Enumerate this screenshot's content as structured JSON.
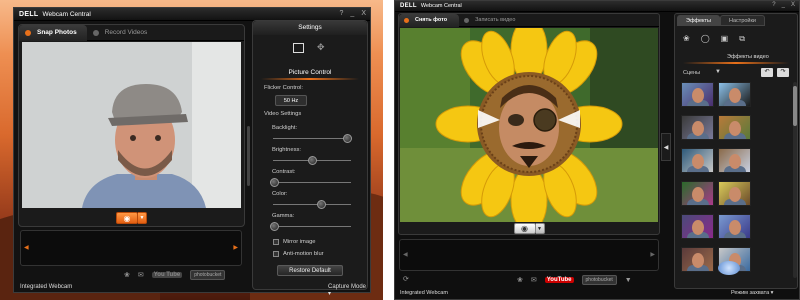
{
  "left_window": {
    "brand": "DELL",
    "title": "Webcam Central",
    "controls": [
      "?",
      "_",
      "X"
    ],
    "tabs": [
      {
        "label": "Snap Photos",
        "active": true
      },
      {
        "label": "Record Videos",
        "active": false
      }
    ],
    "status": "Integrated Webcam",
    "settings": {
      "title": "Settings",
      "section": "Picture Control",
      "flicker_label": "Flicker Control:",
      "flicker_value": "50 Hz",
      "video_settings_label": "Video Settings",
      "sliders": [
        {
          "label": "Backlight:",
          "value": 0.95
        },
        {
          "label": "Brightness:",
          "value": 0.5
        },
        {
          "label": "Contrast:",
          "value": 0.02
        },
        {
          "label": "Color:",
          "value": 0.62
        },
        {
          "label": "Gamma:",
          "value": 0.02
        }
      ],
      "checkboxes": [
        {
          "label": "Mirror image",
          "checked": false
        },
        {
          "label": "Anti-motion blur",
          "checked": false
        }
      ],
      "restore_label": "Restore Default",
      "capture_mode": "Capture Mode"
    },
    "bottom_icons": [
      "effects-icon",
      "mail-icon",
      "youtube-icon",
      "photobucket-icon"
    ],
    "youtube_label": "You Tube",
    "photobucket_label": "photobucket"
  },
  "right_window": {
    "brand": "DELL",
    "title": "Webcam Central",
    "controls": [
      "?",
      "_",
      "X"
    ],
    "tabs": [
      {
        "label": "Снять фото",
        "active": true
      },
      {
        "label": "Записать видео",
        "active": false
      }
    ],
    "side_tabs": [
      {
        "label": "Эффекты",
        "active": true
      },
      {
        "label": "Настройки",
        "active": false
      }
    ],
    "effects_label": "Эффекты видео",
    "scenes_label": "Сцены",
    "status": "Integrated Webcam",
    "mode_label": "Режим захвата",
    "youtube_label": "YouTube",
    "photobucket_label": "photobucket"
  },
  "colors": {
    "accent": "#e8701a",
    "window_bg": "#121212",
    "panel_bg": "#1b1b1b"
  }
}
